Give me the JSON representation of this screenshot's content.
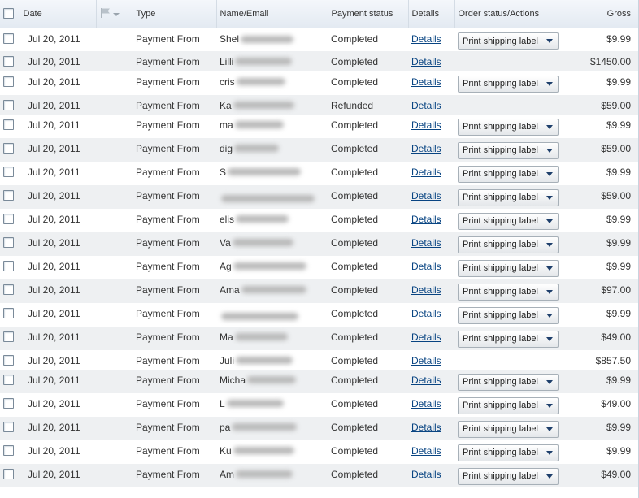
{
  "table": {
    "headers": {
      "date": "Date",
      "type": "Type",
      "name_email": "Name/Email",
      "payment_status": "Payment status",
      "details": "Details",
      "order_status": "Order status/Actions",
      "gross": "Gross"
    },
    "header_icons": {
      "flag": "flag-icon",
      "dropdown": "caret-down-icon"
    },
    "rows": [
      {
        "date": "Jul 20, 2011",
        "type": "Payment From",
        "name": "Shel",
        "status": "Completed",
        "details": "Details",
        "action": "Print shipping label",
        "gross": "$9.99"
      },
      {
        "date": "Jul 20, 2011",
        "type": "Payment From",
        "name": "Lilli",
        "status": "Completed",
        "details": "Details",
        "action": "",
        "gross": "$1450.00"
      },
      {
        "date": "Jul 20, 2011",
        "type": "Payment From",
        "name": "cris",
        "status": "Completed",
        "details": "Details",
        "action": "Print shipping label",
        "gross": "$9.99"
      },
      {
        "date": "Jul 20, 2011",
        "type": "Payment From",
        "name": "Ka",
        "status": "Refunded",
        "details": "Details",
        "action": "",
        "gross": "$59.00"
      },
      {
        "date": "Jul 20, 2011",
        "type": "Payment From",
        "name": "ma",
        "status": "Completed",
        "details": "Details",
        "action": "Print shipping label",
        "gross": "$9.99"
      },
      {
        "date": "Jul 20, 2011",
        "type": "Payment From",
        "name": "dig",
        "status": "Completed",
        "details": "Details",
        "action": "Print shipping label",
        "gross": "$59.00"
      },
      {
        "date": "Jul 20, 2011",
        "type": "Payment From",
        "name": "S",
        "status": "Completed",
        "details": "Details",
        "action": "Print shipping label",
        "gross": "$9.99"
      },
      {
        "date": "Jul 20, 2011",
        "type": "Payment From",
        "name": "",
        "status": "Completed",
        "details": "Details",
        "action": "Print shipping label",
        "gross": "$59.00"
      },
      {
        "date": "Jul 20, 2011",
        "type": "Payment From",
        "name": "elis",
        "status": "Completed",
        "details": "Details",
        "action": "Print shipping label",
        "gross": "$9.99"
      },
      {
        "date": "Jul 20, 2011",
        "type": "Payment From",
        "name": "Va",
        "status": "Completed",
        "details": "Details",
        "action": "Print shipping label",
        "gross": "$9.99"
      },
      {
        "date": "Jul 20, 2011",
        "type": "Payment From",
        "name": "Ag",
        "status": "Completed",
        "details": "Details",
        "action": "Print shipping label",
        "gross": "$9.99"
      },
      {
        "date": "Jul 20, 2011",
        "type": "Payment From",
        "name": "Ama",
        "status": "Completed",
        "details": "Details",
        "action": "Print shipping label",
        "gross": "$97.00"
      },
      {
        "date": "Jul 20, 2011",
        "type": "Payment From",
        "name": "",
        "status": "Completed",
        "details": "Details",
        "action": "Print shipping label",
        "gross": "$9.99"
      },
      {
        "date": "Jul 20, 2011",
        "type": "Payment From",
        "name": "Ma",
        "status": "Completed",
        "details": "Details",
        "action": "Print shipping label",
        "gross": "$49.00"
      },
      {
        "date": "Jul 20, 2011",
        "type": "Payment From",
        "name": "Juli",
        "status": "Completed",
        "details": "Details",
        "action": "",
        "gross": "$857.50"
      },
      {
        "date": "Jul 20, 2011",
        "type": "Payment From",
        "name": "Micha",
        "status": "Completed",
        "details": "Details",
        "action": "Print shipping label",
        "gross": "$9.99"
      },
      {
        "date": "Jul 20, 2011",
        "type": "Payment From",
        "name": "L",
        "status": "Completed",
        "details": "Details",
        "action": "Print shipping label",
        "gross": "$49.00"
      },
      {
        "date": "Jul 20, 2011",
        "type": "Payment From",
        "name": "pa",
        "status": "Completed",
        "details": "Details",
        "action": "Print shipping label",
        "gross": "$9.99"
      },
      {
        "date": "Jul 20, 2011",
        "type": "Payment From",
        "name": "Ku",
        "status": "Completed",
        "details": "Details",
        "action": "Print shipping label",
        "gross": "$9.99"
      },
      {
        "date": "Jul 20, 2011",
        "type": "Payment From",
        "name": "Am",
        "status": "Completed",
        "details": "Details",
        "action": "Print shipping label",
        "gross": "$49.00"
      }
    ]
  }
}
